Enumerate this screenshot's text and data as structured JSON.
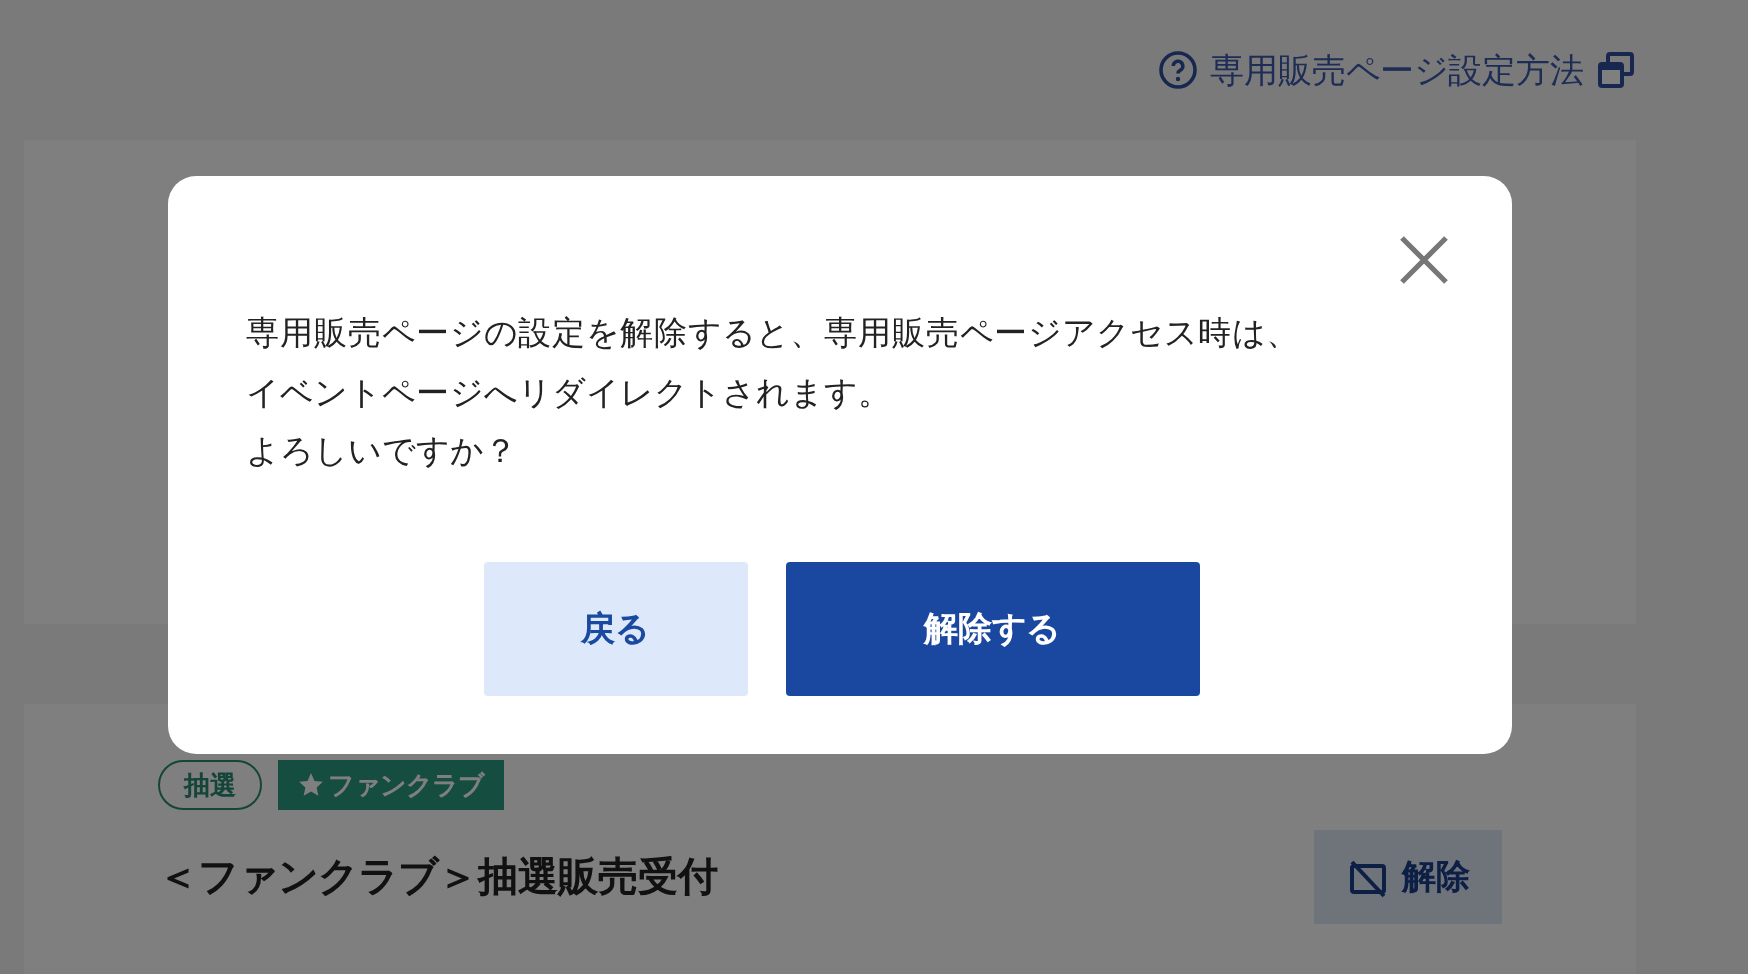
{
  "header_link": {
    "label": "専用販売ページ設定方法"
  },
  "event_card": {
    "tags": [
      {
        "label": "抽選",
        "kind": "outline"
      },
      {
        "label": "ファンクラブ",
        "kind": "fanclub"
      }
    ],
    "title": "＜ファンクラブ＞抽選販売受付",
    "action": "解除"
  },
  "dialog": {
    "message_lines": [
      "専用販売ページの設定を解除すると、専用販売ページアクセス時は、",
      "イベントページへリダイレクトされます。",
      "よろしいですか？"
    ],
    "buttons": [
      {
        "label": "戻る",
        "kind": "secondary"
      },
      {
        "label": "解除する",
        "kind": "primary"
      }
    ]
  }
}
